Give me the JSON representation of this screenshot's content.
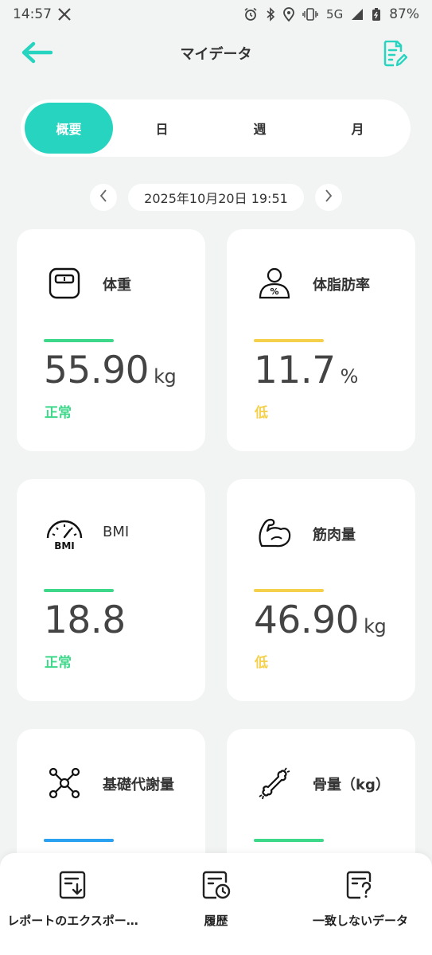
{
  "status_bar": {
    "time": "14:57",
    "network": "5G",
    "battery": "87%"
  },
  "header": {
    "title": "マイデータ"
  },
  "tabs": [
    {
      "label": "概要",
      "active": true
    },
    {
      "label": "日",
      "active": false
    },
    {
      "label": "週",
      "active": false
    },
    {
      "label": "月",
      "active": false
    }
  ],
  "date": {
    "value": "2025年10月20日 19:51"
  },
  "colors": {
    "accent": "#27d4bf",
    "normal": "#3ed88a",
    "low": "#f5d04a",
    "blue": "#2aa1f0"
  },
  "cards": [
    {
      "label": "体重",
      "value": "55.90",
      "unit": "kg",
      "status": "正常",
      "icon": "scale-icon"
    },
    {
      "label": "体脂肪率",
      "value": "11.7",
      "unit": "%",
      "status": "低",
      "icon": "body-fat-icon"
    },
    {
      "label": "BMI",
      "value": "18.8",
      "unit": "",
      "status": "正常",
      "icon": "bmi-gauge-icon"
    },
    {
      "label": "筋肉量",
      "value": "46.90",
      "unit": "kg",
      "status": "低",
      "icon": "muscle-arm-icon"
    },
    {
      "label": "基礎代謝量",
      "value": "",
      "unit": "",
      "status": "",
      "icon": "metabolism-molecule-icon"
    },
    {
      "label": "骨量（kg）",
      "value": "",
      "unit": "",
      "status": "",
      "icon": "bone-icon"
    }
  ],
  "bottom_bar": {
    "export_label": "レポートのエクスポー…",
    "history_label": "履歴",
    "mismatch_label": "一致しないデータ"
  }
}
